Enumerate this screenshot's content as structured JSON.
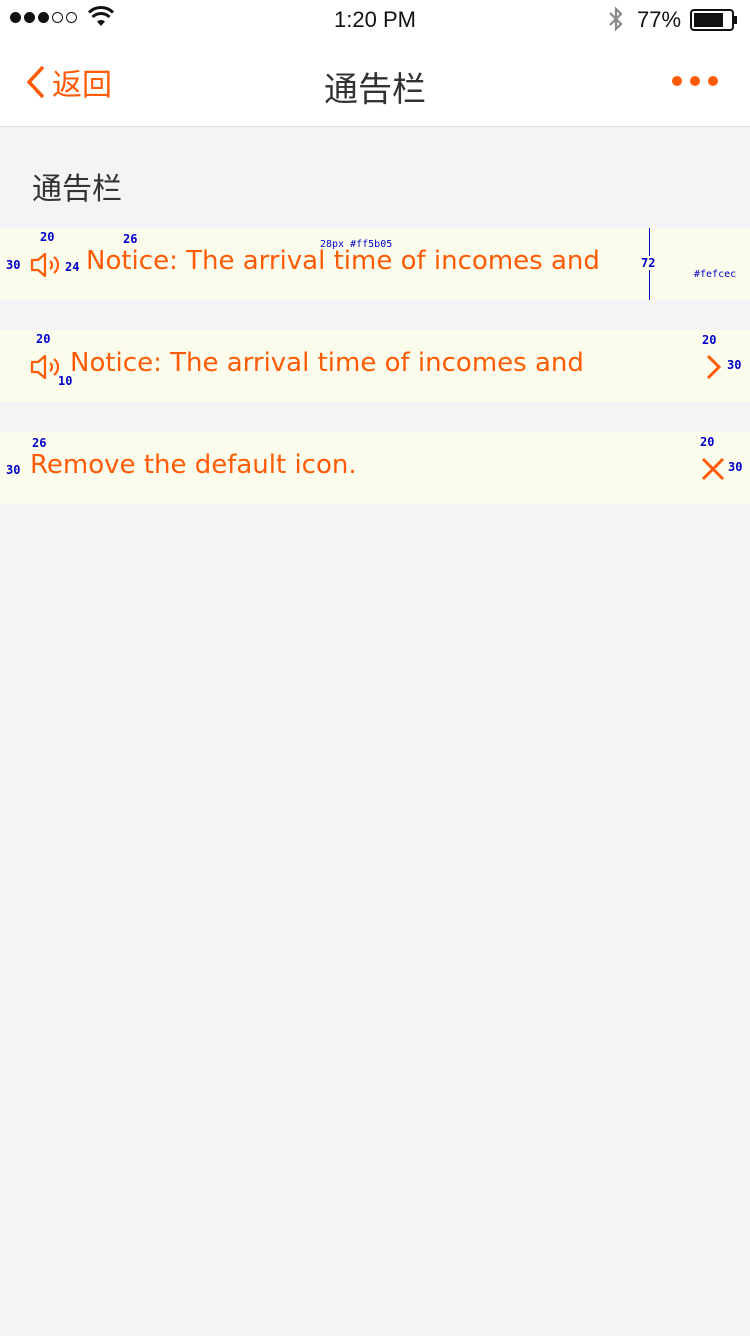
{
  "status_bar": {
    "time": "1:20 PM",
    "battery_percent": "77%",
    "signal_bars": 3
  },
  "nav": {
    "back_label": "返回",
    "title": "通告栏",
    "more_icon": "more-dots-icon"
  },
  "section": {
    "title": "通告栏"
  },
  "notices": [
    {
      "text": "Notice: The arrival time of incomes and",
      "leading_icon": "speaker-icon",
      "trailing_icon": null
    },
    {
      "text": "Notice: The arrival time of incomes and",
      "leading_icon": "speaker-icon",
      "trailing_icon": "chevron-right-icon"
    },
    {
      "text": "Remove the default icon.",
      "leading_icon": null,
      "trailing_icon": "close-icon"
    }
  ],
  "annotations": {
    "n1_left": "30",
    "n1_icon_top": "20",
    "n1_text_top": "26",
    "n1_icon_gap": "24",
    "n1_font": "28px #ff5b05",
    "n1_height": "72",
    "n1_bg": "#fefcec",
    "n2_icon_top": "20",
    "n2_icon_gap": "10",
    "n2_right_top": "20",
    "n2_right": "30",
    "n3_text_top": "26",
    "n3_left": "30",
    "n3_right_top": "20",
    "n3_right": "30"
  },
  "colors": {
    "accent": "#ff5b05",
    "notice_bg": "#fcfcec",
    "page_bg": "#f4f4f6",
    "annotation": "#0000cc"
  }
}
